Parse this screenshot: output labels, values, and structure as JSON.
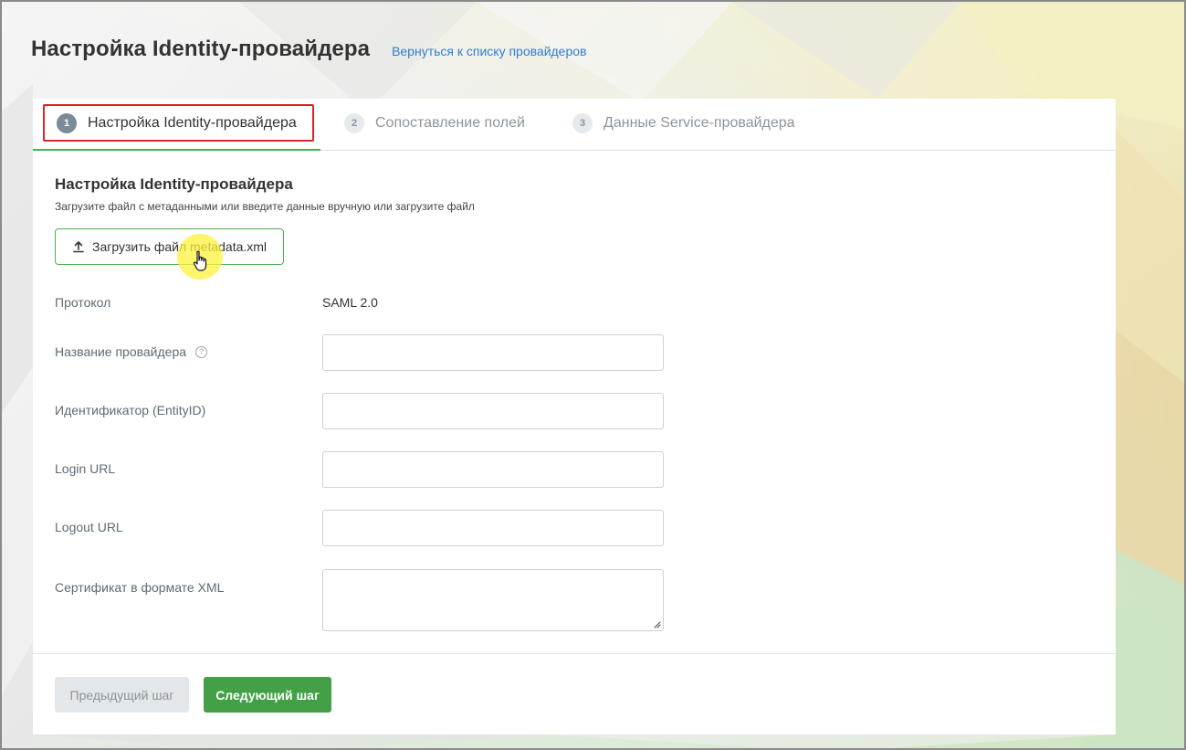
{
  "header": {
    "title": "Настройка Identity-провайдера",
    "back_link": "Вернуться к списку провайдеров"
  },
  "tabs": [
    {
      "number": "1",
      "label": "Настройка Identity-провайдера",
      "active": true
    },
    {
      "number": "2",
      "label": "Сопоставление полей",
      "active": false
    },
    {
      "number": "3",
      "label": "Данные Service-провайдера",
      "active": false
    }
  ],
  "section": {
    "title": "Настройка Identity-провайдера",
    "subtitle": "Загрузите файл с метаданными или введите данные вручную или загрузите файл",
    "upload_label": "Загрузить файл metadata.xml"
  },
  "form": {
    "protocol_label": "Протокол",
    "protocol_value": "SAML 2.0",
    "provider_name_label": "Название провайдера",
    "provider_name_value": "",
    "entity_id_label": "Идентификатор (EntityID)",
    "entity_id_value": "",
    "login_url_label": "Login URL",
    "login_url_value": "",
    "logout_url_label": "Logout URL",
    "logout_url_value": "",
    "certificate_label": "Сертификат в формате XML",
    "certificate_value": ""
  },
  "footer": {
    "prev_label": "Предыдущий шаг",
    "next_label": "Следующий шаг"
  },
  "icons": {
    "upload": "upload-icon",
    "help": "question-circle-icon",
    "cursor": "hand-pointer-icon"
  },
  "colors": {
    "accent_green": "#43a047",
    "link_blue": "#2d7fd3",
    "highlight_red": "#d9252b",
    "cursor_highlight": "#fff23c"
  }
}
